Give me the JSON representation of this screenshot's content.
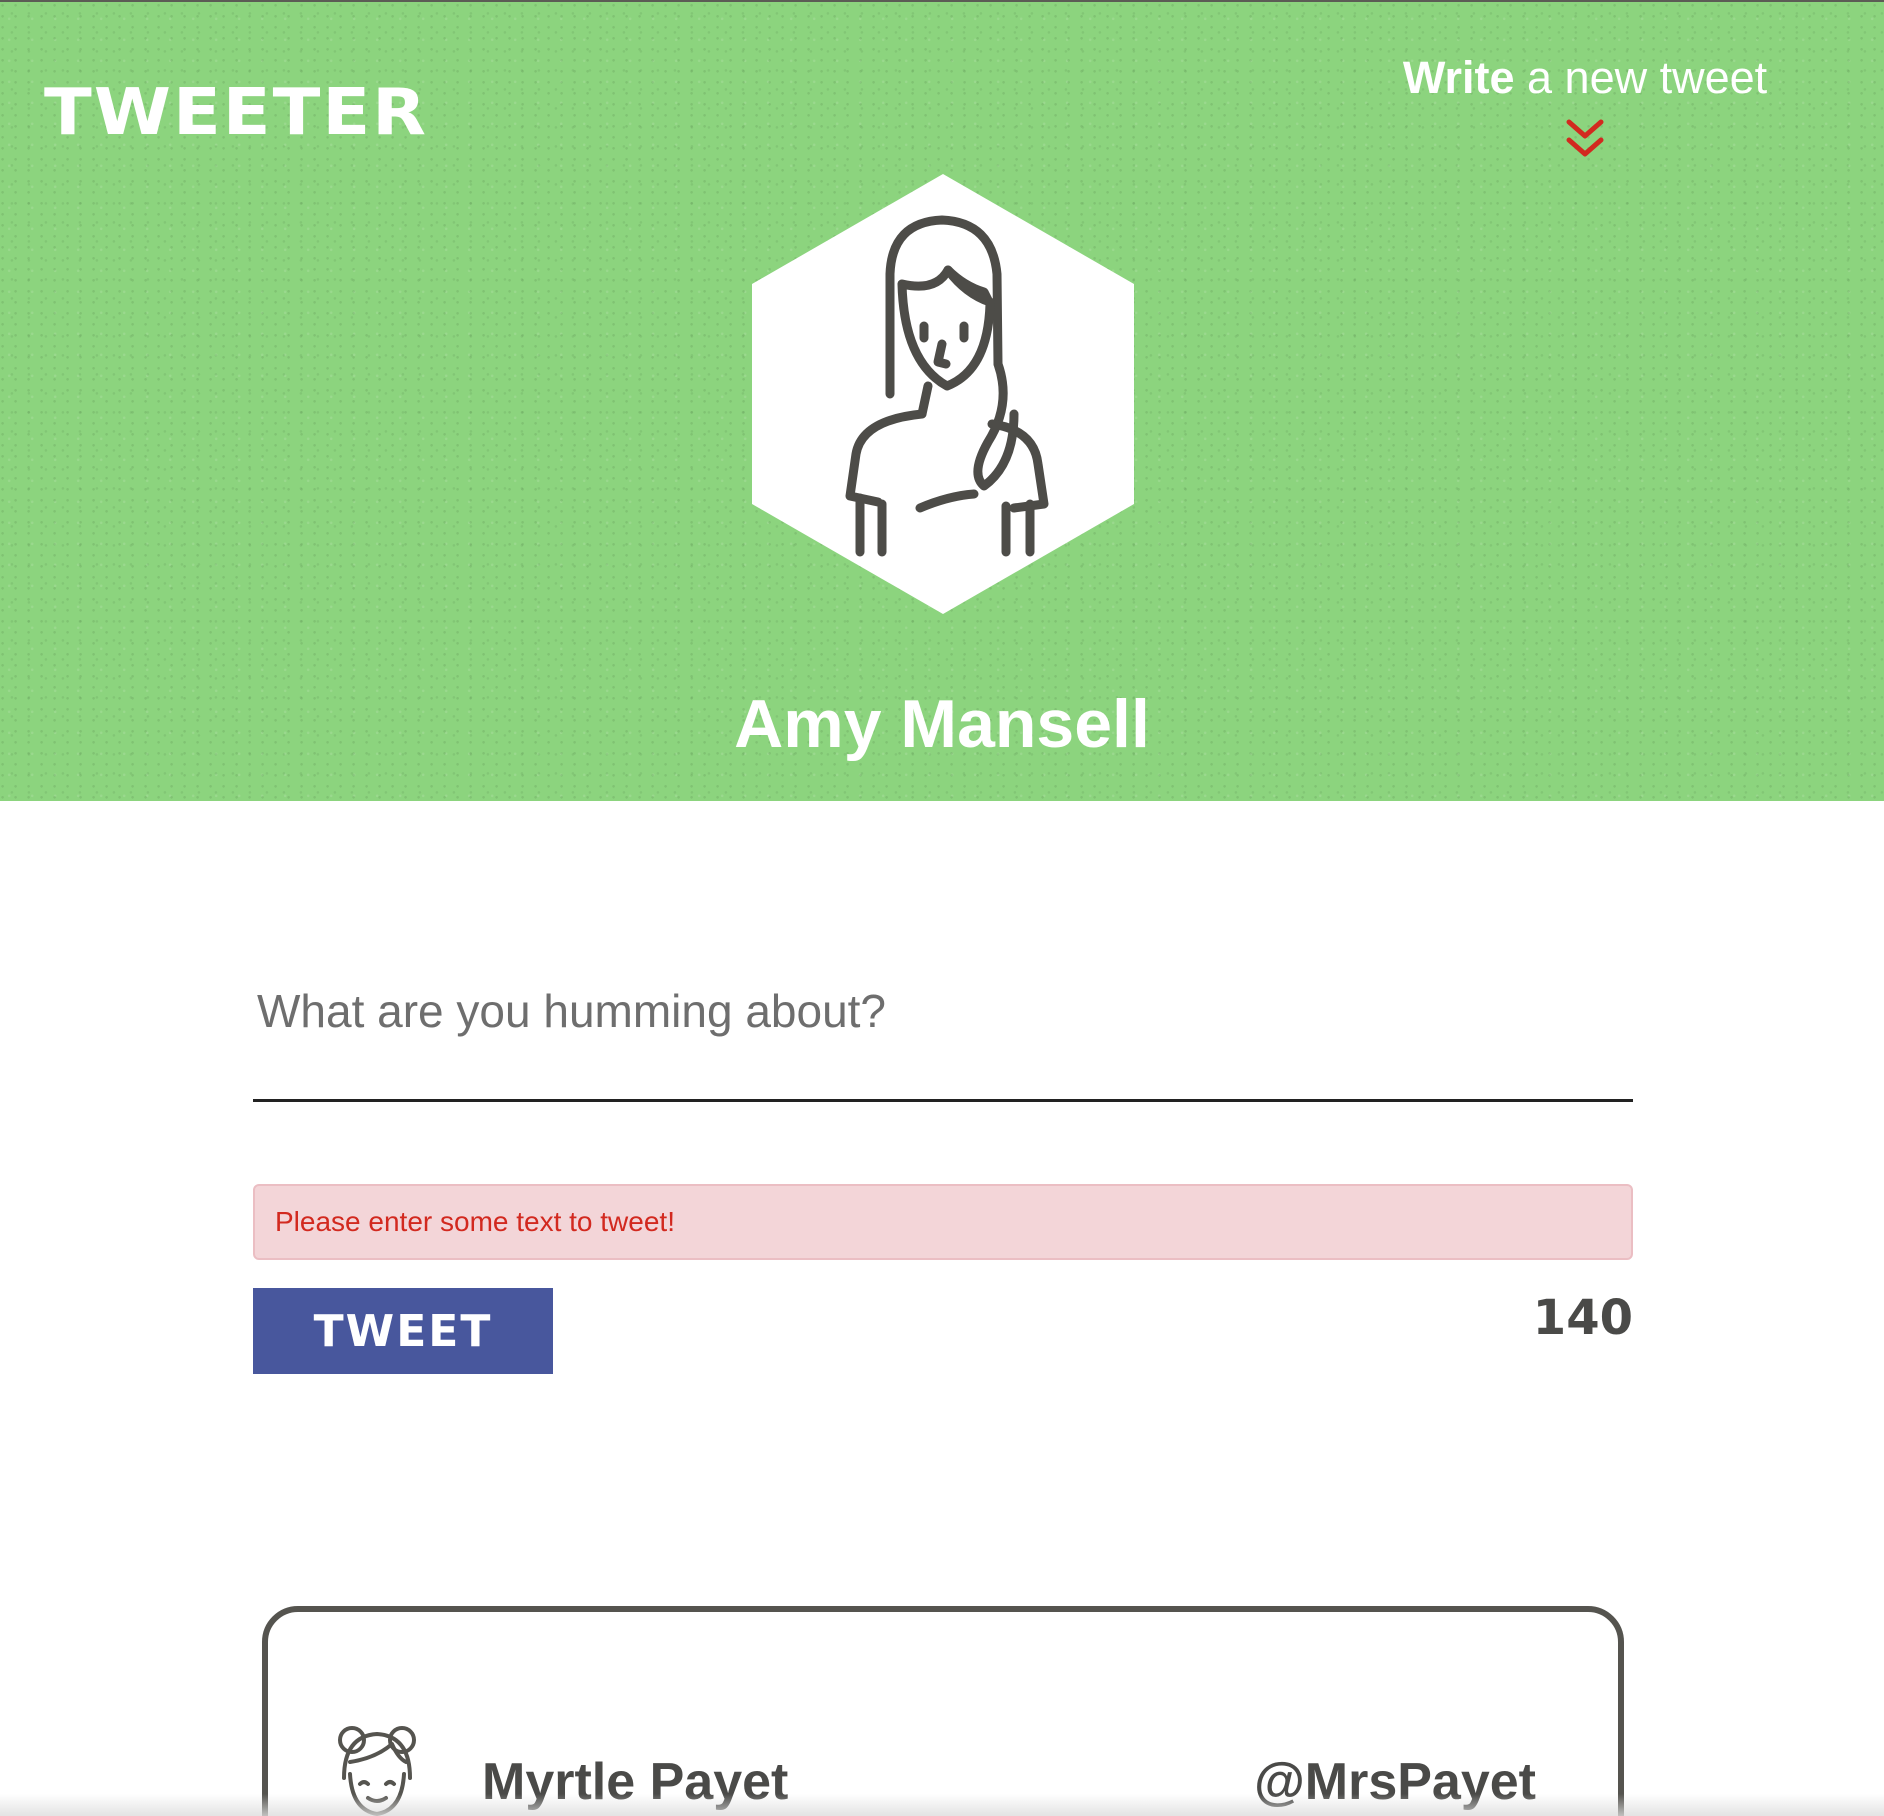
{
  "header": {
    "logo": "TWEETER",
    "compose_toggle": {
      "bold": "Write",
      "rest": " a new tweet",
      "icon": "double-chevron-down-icon",
      "icon_color": "#d2291f"
    },
    "profile": {
      "name": "Amy Mansell",
      "avatar_icon": "woman-avatar-icon"
    },
    "background_color": "#8cd47e"
  },
  "compose": {
    "placeholder": "What are you humming about?",
    "value": "",
    "error": "Please enter some text to tweet!",
    "button_label": "TWEET",
    "button_color": "#48579d",
    "counter": "140"
  },
  "tweets": [
    {
      "name": "Myrtle Payet",
      "handle": "@MrsPayet",
      "avatar_icon": "girl-avatar-icon"
    }
  ]
}
